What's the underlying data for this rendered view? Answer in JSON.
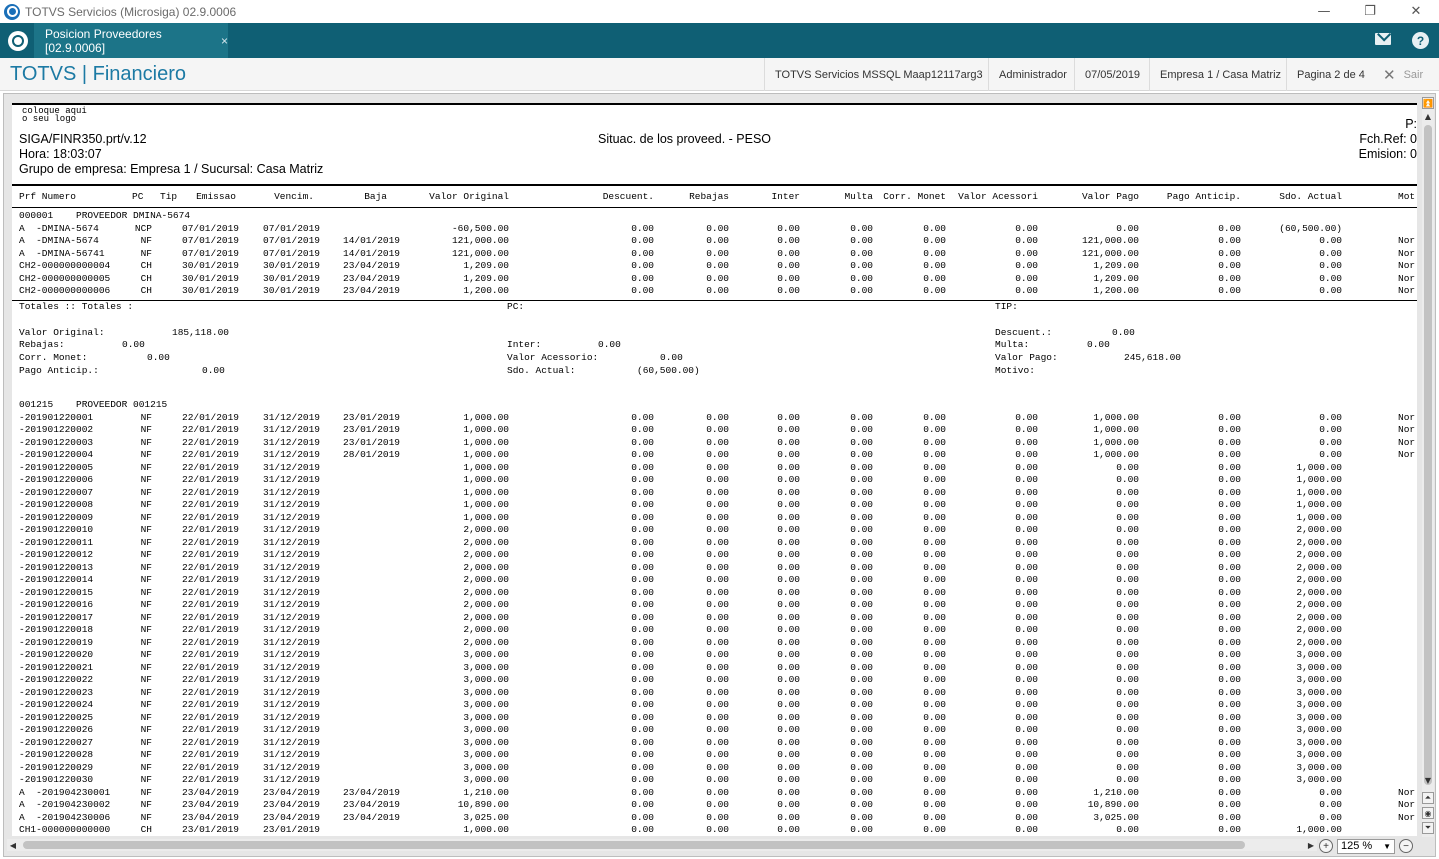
{
  "window": {
    "title": "TOTVS Servicios (Microsiga) 02.9.0006",
    "minimize": "—",
    "maximize": "❐",
    "close": "✕"
  },
  "tabbar": {
    "tab_label": "Posicion Proveedores [02.9.0006]",
    "tab_close": "×",
    "help": "?"
  },
  "header": {
    "brand": "TOTVS | Financiero",
    "server": "TOTVS Servicios MSSQL Maap12117arg3",
    "user": "Administrador",
    "date": "07/05/2019",
    "company": "Empresa 1 / Casa Matriz",
    "page": "Pagina 2 de 4",
    "sair": "Sair"
  },
  "report": {
    "logo_text": "coloque aqui\no seu logo",
    "program": "SIGA/FINR350.prt/v.12",
    "title": "Situac. de los proveed. - PESO",
    "hora": "Hora: 18:03:07",
    "grupo": "Grupo de empresa: Empresa 1 / Sucursal: Casa Matriz",
    "right1": "P:",
    "right2": "Fch.Ref: 0",
    "right3": "Emision: 0",
    "columns": [
      "Prf Numero",
      "PC",
      "Tip",
      "Emissao",
      "Vencim.",
      "Baja",
      "Valor Original",
      "Descuent.",
      "Rebajas",
      "Inter",
      "Multa",
      "Corr. Monet",
      "Valor Acessori",
      "Valor Pago",
      "Pago Anticip.",
      "Sdo. Actual",
      "Mot"
    ],
    "group1": {
      "header": "000001    PROVEEDOR DMINA-5674",
      "rows": [
        [
          "A  -DMINA-5674",
          "NCP",
          "07/01/2019",
          "07/01/2019",
          "",
          "-60,500.00",
          "0.00",
          "0.00",
          "0.00",
          "0.00",
          "0.00",
          "0.00",
          "0.00",
          "0.00",
          "(60,500.00)",
          ""
        ],
        [
          "A  -DMINA-5674",
          "NF",
          "07/01/2019",
          "07/01/2019",
          "14/01/2019",
          "121,000.00",
          "0.00",
          "0.00",
          "0.00",
          "0.00",
          "0.00",
          "0.00",
          "121,000.00",
          "0.00",
          "0.00",
          "Nor"
        ],
        [
          "A  -DMINA-56741",
          "NF",
          "07/01/2019",
          "07/01/2019",
          "14/01/2019",
          "121,000.00",
          "0.00",
          "0.00",
          "0.00",
          "0.00",
          "0.00",
          "0.00",
          "121,000.00",
          "0.00",
          "0.00",
          "Nor"
        ],
        [
          "CH2-000000000004",
          "CH",
          "30/01/2019",
          "30/01/2019",
          "23/04/2019",
          "1,209.00",
          "0.00",
          "0.00",
          "0.00",
          "0.00",
          "0.00",
          "0.00",
          "1,209.00",
          "0.00",
          "0.00",
          "Nor"
        ],
        [
          "CH2-000000000005",
          "CH",
          "30/01/2019",
          "30/01/2019",
          "23/04/2019",
          "1,209.00",
          "0.00",
          "0.00",
          "0.00",
          "0.00",
          "0.00",
          "0.00",
          "1,209.00",
          "0.00",
          "0.00",
          "Nor"
        ],
        [
          "CH2-000000000006",
          "CH",
          "30/01/2019",
          "30/01/2019",
          "23/04/2019",
          "1,200.00",
          "0.00",
          "0.00",
          "0.00",
          "0.00",
          "0.00",
          "0.00",
          "1,200.00",
          "0.00",
          "0.00",
          "Nor"
        ]
      ]
    },
    "totals": {
      "label": "Totales :: Totales :",
      "pc": "PC:",
      "tip": "TIP:",
      "valor_original_label": "Valor Original:",
      "valor_original": "185,118.00",
      "descuent_label": "Descuent.:",
      "descuent": "0.00",
      "rebajas_label": "Rebajas:",
      "rebajas": "0.00",
      "inter_label": "Inter:",
      "inter": "0.00",
      "multa_label": "Multa:",
      "multa": "0.00",
      "corr_label": "Corr. Monet:",
      "corr": "0.00",
      "acess_label": "Valor Acessorio:",
      "acess": "0.00",
      "pago_label": "Valor Pago:",
      "pago": "245,618.00",
      "anticip_label": "Pago Anticip.:",
      "anticip": "0.00",
      "sdo_label": "Sdo. Actual:",
      "sdo": "(60,500.00)",
      "motivo_label": "Motivo:"
    },
    "group2": {
      "header": "001215    PROVEEDOR 001215",
      "rows": [
        [
          "-201901220001",
          "NF",
          "22/01/2019",
          "31/12/2019",
          "23/01/2019",
          "1,000.00",
          "0.00",
          "0.00",
          "0.00",
          "0.00",
          "0.00",
          "0.00",
          "1,000.00",
          "0.00",
          "0.00",
          "Nor"
        ],
        [
          "-201901220002",
          "NF",
          "22/01/2019",
          "31/12/2019",
          "23/01/2019",
          "1,000.00",
          "0.00",
          "0.00",
          "0.00",
          "0.00",
          "0.00",
          "0.00",
          "1,000.00",
          "0.00",
          "0.00",
          "Nor"
        ],
        [
          "-201901220003",
          "NF",
          "22/01/2019",
          "31/12/2019",
          "23/01/2019",
          "1,000.00",
          "0.00",
          "0.00",
          "0.00",
          "0.00",
          "0.00",
          "0.00",
          "1,000.00",
          "0.00",
          "0.00",
          "Nor"
        ],
        [
          "-201901220004",
          "NF",
          "22/01/2019",
          "31/12/2019",
          "28/01/2019",
          "1,000.00",
          "0.00",
          "0.00",
          "0.00",
          "0.00",
          "0.00",
          "0.00",
          "1,000.00",
          "0.00",
          "0.00",
          "Nor"
        ],
        [
          "-201901220005",
          "NF",
          "22/01/2019",
          "31/12/2019",
          "",
          "1,000.00",
          "0.00",
          "0.00",
          "0.00",
          "0.00",
          "0.00",
          "0.00",
          "0.00",
          "0.00",
          "1,000.00",
          ""
        ],
        [
          "-201901220006",
          "NF",
          "22/01/2019",
          "31/12/2019",
          "",
          "1,000.00",
          "0.00",
          "0.00",
          "0.00",
          "0.00",
          "0.00",
          "0.00",
          "0.00",
          "0.00",
          "1,000.00",
          ""
        ],
        [
          "-201901220007",
          "NF",
          "22/01/2019",
          "31/12/2019",
          "",
          "1,000.00",
          "0.00",
          "0.00",
          "0.00",
          "0.00",
          "0.00",
          "0.00",
          "0.00",
          "0.00",
          "1,000.00",
          ""
        ],
        [
          "-201901220008",
          "NF",
          "22/01/2019",
          "31/12/2019",
          "",
          "1,000.00",
          "0.00",
          "0.00",
          "0.00",
          "0.00",
          "0.00",
          "0.00",
          "0.00",
          "0.00",
          "1,000.00",
          ""
        ],
        [
          "-201901220009",
          "NF",
          "22/01/2019",
          "31/12/2019",
          "",
          "1,000.00",
          "0.00",
          "0.00",
          "0.00",
          "0.00",
          "0.00",
          "0.00",
          "0.00",
          "0.00",
          "1,000.00",
          ""
        ],
        [
          "-201901220010",
          "NF",
          "22/01/2019",
          "31/12/2019",
          "",
          "2,000.00",
          "0.00",
          "0.00",
          "0.00",
          "0.00",
          "0.00",
          "0.00",
          "0.00",
          "0.00",
          "2,000.00",
          ""
        ],
        [
          "-201901220011",
          "NF",
          "22/01/2019",
          "31/12/2019",
          "",
          "2,000.00",
          "0.00",
          "0.00",
          "0.00",
          "0.00",
          "0.00",
          "0.00",
          "0.00",
          "0.00",
          "2,000.00",
          ""
        ],
        [
          "-201901220012",
          "NF",
          "22/01/2019",
          "31/12/2019",
          "",
          "2,000.00",
          "0.00",
          "0.00",
          "0.00",
          "0.00",
          "0.00",
          "0.00",
          "0.00",
          "0.00",
          "2,000.00",
          ""
        ],
        [
          "-201901220013",
          "NF",
          "22/01/2019",
          "31/12/2019",
          "",
          "2,000.00",
          "0.00",
          "0.00",
          "0.00",
          "0.00",
          "0.00",
          "0.00",
          "0.00",
          "0.00",
          "2,000.00",
          ""
        ],
        [
          "-201901220014",
          "NF",
          "22/01/2019",
          "31/12/2019",
          "",
          "2,000.00",
          "0.00",
          "0.00",
          "0.00",
          "0.00",
          "0.00",
          "0.00",
          "0.00",
          "0.00",
          "2,000.00",
          ""
        ],
        [
          "-201901220015",
          "NF",
          "22/01/2019",
          "31/12/2019",
          "",
          "2,000.00",
          "0.00",
          "0.00",
          "0.00",
          "0.00",
          "0.00",
          "0.00",
          "0.00",
          "0.00",
          "2,000.00",
          ""
        ],
        [
          "-201901220016",
          "NF",
          "22/01/2019",
          "31/12/2019",
          "",
          "2,000.00",
          "0.00",
          "0.00",
          "0.00",
          "0.00",
          "0.00",
          "0.00",
          "0.00",
          "0.00",
          "2,000.00",
          ""
        ],
        [
          "-201901220017",
          "NF",
          "22/01/2019",
          "31/12/2019",
          "",
          "2,000.00",
          "0.00",
          "0.00",
          "0.00",
          "0.00",
          "0.00",
          "0.00",
          "0.00",
          "0.00",
          "2,000.00",
          ""
        ],
        [
          "-201901220018",
          "NF",
          "22/01/2019",
          "31/12/2019",
          "",
          "2,000.00",
          "0.00",
          "0.00",
          "0.00",
          "0.00",
          "0.00",
          "0.00",
          "0.00",
          "0.00",
          "2,000.00",
          ""
        ],
        [
          "-201901220019",
          "NF",
          "22/01/2019",
          "31/12/2019",
          "",
          "2,000.00",
          "0.00",
          "0.00",
          "0.00",
          "0.00",
          "0.00",
          "0.00",
          "0.00",
          "0.00",
          "2,000.00",
          ""
        ],
        [
          "-201901220020",
          "NF",
          "22/01/2019",
          "31/12/2019",
          "",
          "3,000.00",
          "0.00",
          "0.00",
          "0.00",
          "0.00",
          "0.00",
          "0.00",
          "0.00",
          "0.00",
          "3,000.00",
          ""
        ],
        [
          "-201901220021",
          "NF",
          "22/01/2019",
          "31/12/2019",
          "",
          "3,000.00",
          "0.00",
          "0.00",
          "0.00",
          "0.00",
          "0.00",
          "0.00",
          "0.00",
          "0.00",
          "3,000.00",
          ""
        ],
        [
          "-201901220022",
          "NF",
          "22/01/2019",
          "31/12/2019",
          "",
          "3,000.00",
          "0.00",
          "0.00",
          "0.00",
          "0.00",
          "0.00",
          "0.00",
          "0.00",
          "0.00",
          "3,000.00",
          ""
        ],
        [
          "-201901220023",
          "NF",
          "22/01/2019",
          "31/12/2019",
          "",
          "3,000.00",
          "0.00",
          "0.00",
          "0.00",
          "0.00",
          "0.00",
          "0.00",
          "0.00",
          "0.00",
          "3,000.00",
          ""
        ],
        [
          "-201901220024",
          "NF",
          "22/01/2019",
          "31/12/2019",
          "",
          "3,000.00",
          "0.00",
          "0.00",
          "0.00",
          "0.00",
          "0.00",
          "0.00",
          "0.00",
          "0.00",
          "3,000.00",
          ""
        ],
        [
          "-201901220025",
          "NF",
          "22/01/2019",
          "31/12/2019",
          "",
          "3,000.00",
          "0.00",
          "0.00",
          "0.00",
          "0.00",
          "0.00",
          "0.00",
          "0.00",
          "0.00",
          "3,000.00",
          ""
        ],
        [
          "-201901220026",
          "NF",
          "22/01/2019",
          "31/12/2019",
          "",
          "3,000.00",
          "0.00",
          "0.00",
          "0.00",
          "0.00",
          "0.00",
          "0.00",
          "0.00",
          "0.00",
          "3,000.00",
          ""
        ],
        [
          "-201901220027",
          "NF",
          "22/01/2019",
          "31/12/2019",
          "",
          "3,000.00",
          "0.00",
          "0.00",
          "0.00",
          "0.00",
          "0.00",
          "0.00",
          "0.00",
          "0.00",
          "3,000.00",
          ""
        ],
        [
          "-201901220028",
          "NF",
          "22/01/2019",
          "31/12/2019",
          "",
          "3,000.00",
          "0.00",
          "0.00",
          "0.00",
          "0.00",
          "0.00",
          "0.00",
          "0.00",
          "0.00",
          "3,000.00",
          ""
        ],
        [
          "-201901220029",
          "NF",
          "22/01/2019",
          "31/12/2019",
          "",
          "3,000.00",
          "0.00",
          "0.00",
          "0.00",
          "0.00",
          "0.00",
          "0.00",
          "0.00",
          "0.00",
          "3,000.00",
          ""
        ],
        [
          "-201901220030",
          "NF",
          "22/01/2019",
          "31/12/2019",
          "",
          "3,000.00",
          "0.00",
          "0.00",
          "0.00",
          "0.00",
          "0.00",
          "0.00",
          "0.00",
          "0.00",
          "3,000.00",
          ""
        ],
        [
          "A  -201904230001",
          "NF",
          "23/04/2019",
          "23/04/2019",
          "23/04/2019",
          "1,210.00",
          "0.00",
          "0.00",
          "0.00",
          "0.00",
          "0.00",
          "0.00",
          "1,210.00",
          "0.00",
          "0.00",
          "Nor"
        ],
        [
          "A  -201904230002",
          "NF",
          "23/04/2019",
          "23/04/2019",
          "23/04/2019",
          "10,890.00",
          "0.00",
          "0.00",
          "0.00",
          "0.00",
          "0.00",
          "0.00",
          "10,890.00",
          "0.00",
          "0.00",
          "Nor"
        ],
        [
          "A  -201904230006",
          "NF",
          "23/04/2019",
          "23/04/2019",
          "23/04/2019",
          "3,025.00",
          "0.00",
          "0.00",
          "0.00",
          "0.00",
          "0.00",
          "0.00",
          "3,025.00",
          "0.00",
          "0.00",
          "Nor"
        ],
        [
          "CH1-000000000000",
          "CH",
          "23/01/2019",
          "23/01/2019",
          "",
          "1,000.00",
          "0.00",
          "0.00",
          "0.00",
          "0.00",
          "0.00",
          "0.00",
          "0.00",
          "0.00",
          "1,000.00",
          ""
        ]
      ]
    }
  },
  "zoom": {
    "value": "125 %",
    "plus": "+",
    "minus": "−"
  },
  "scroll": {
    "up": "▲",
    "down": "▼",
    "left": "◀",
    "right": "▶",
    "top_btn": "⏶",
    "page_btn": "◉",
    "bottom_btn": "⏷",
    "first_btn": "⏫"
  }
}
